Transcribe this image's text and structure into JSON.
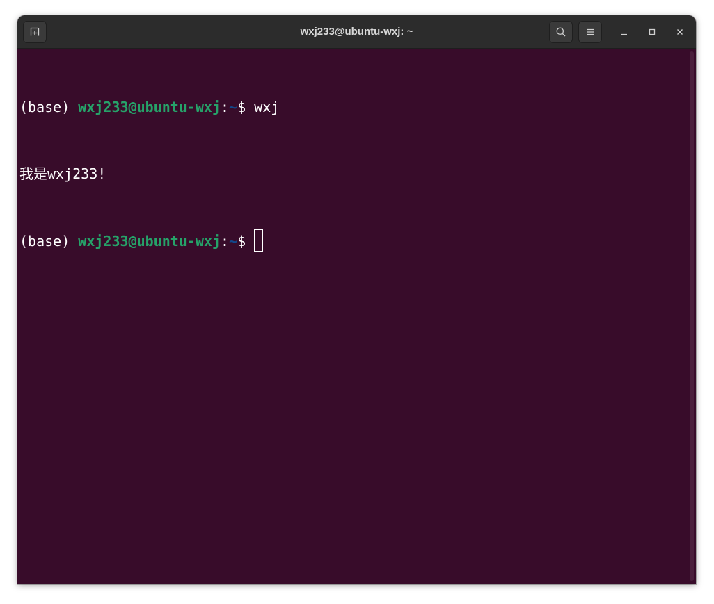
{
  "window": {
    "title": "wxj233@ubuntu-wxj: ~"
  },
  "headerbar": {
    "new_tab_icon": "new-tab-icon",
    "search_icon": "search-icon",
    "menu_icon": "hamburger-menu-icon",
    "minimize_icon": "minimize-icon",
    "maximize_icon": "maximize-icon",
    "close_icon": "close-icon"
  },
  "terminal": {
    "colors": {
      "background": "#380c2a",
      "foreground": "#ffffff",
      "user_host": "#26a269",
      "path": "#12488b"
    },
    "lines": [
      {
        "env": "(base) ",
        "user_host": "wxj233@ubuntu-wxj",
        "colon": ":",
        "path": "~",
        "symbol": "$ ",
        "command": "wxj"
      },
      {
        "output": "我是wxj233!"
      },
      {
        "env": "(base) ",
        "user_host": "wxj233@ubuntu-wxj",
        "colon": ":",
        "path": "~",
        "symbol": "$ ",
        "command": ""
      }
    ]
  }
}
